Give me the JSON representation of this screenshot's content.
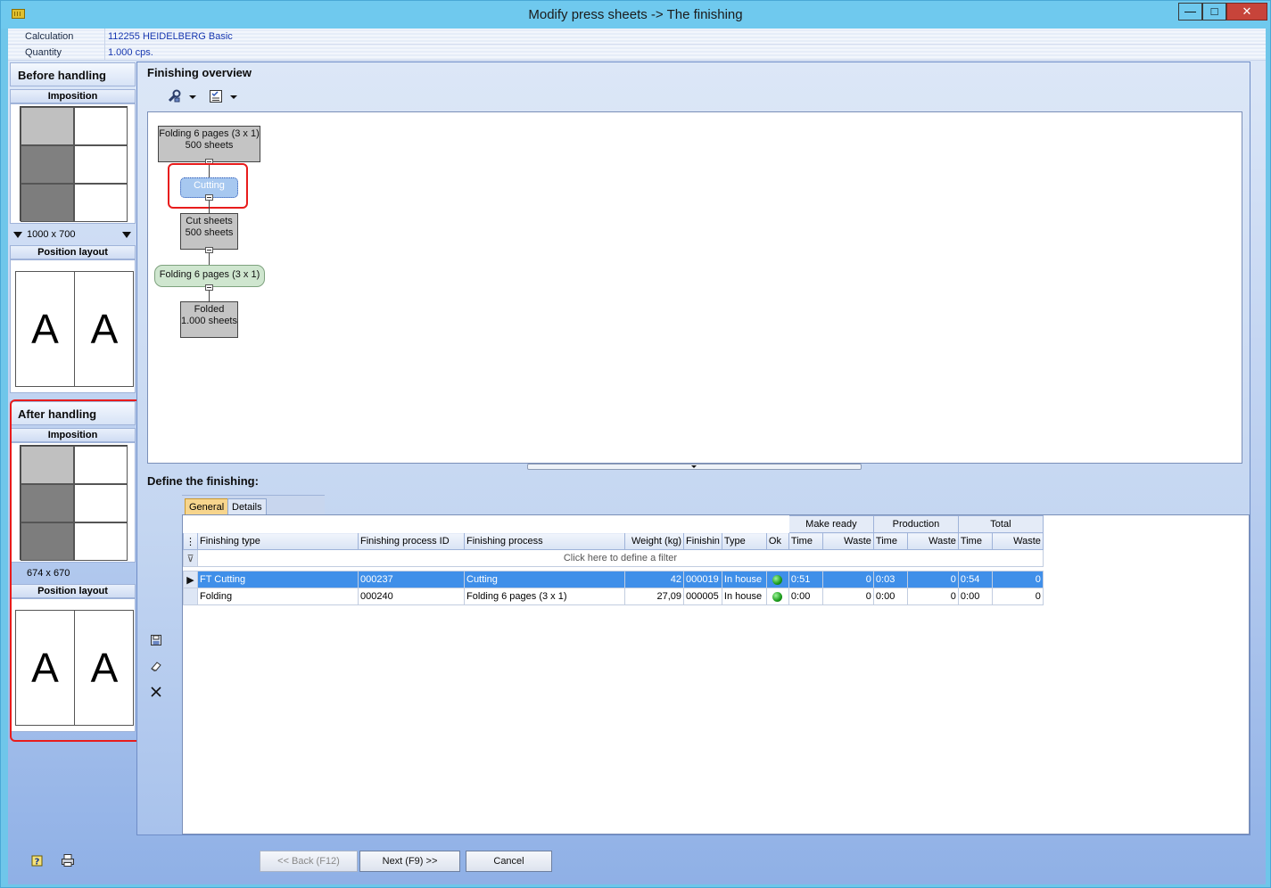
{
  "window": {
    "title": "Modify press sheets -> The finishing",
    "minimize_glyph": "—",
    "maximize_glyph": "□",
    "close_glyph": "✕"
  },
  "info": {
    "calculation_label": "Calculation",
    "calculation_value": "112255 HEIDELBERG Basic",
    "quantity_label": "Quantity",
    "quantity_value": "1.000 cps."
  },
  "before": {
    "header": "Before handling",
    "imposition_label": "Imposition",
    "size": "1000 x 700",
    "position_layout_label": "Position layout",
    "letter_left": "A",
    "letter_right": "A"
  },
  "after": {
    "header": "After handling",
    "imposition_label": "Imposition",
    "size": "674 x 670",
    "position_layout_label": "Position layout",
    "letter_left": "A",
    "letter_right": "A"
  },
  "overview": {
    "title": "Finishing overview",
    "nodes": [
      {
        "line1": "Folding 6 pages (3 x 1)",
        "line2": "500 sheets"
      },
      {
        "line1": "Cutting",
        "line2": ""
      },
      {
        "line1": "Cut sheets",
        "line2": "500 sheets"
      },
      {
        "line1": "Folding 6 pages (3 x 1)",
        "line2": ""
      },
      {
        "line1": "Folded",
        "line2": "1.000 sheets"
      }
    ]
  },
  "define": {
    "title": "Define the finishing:",
    "tabs": [
      "General",
      "Details"
    ],
    "bands": {
      "make_ready": "Make ready",
      "production": "Production",
      "total": "Total"
    },
    "columns": [
      "Finishing type",
      "Finishing process ID",
      "Finishing process",
      "Weight (kg)",
      "Finishin",
      "Type",
      "Ok",
      "Time",
      "Waste",
      "Time",
      "Waste",
      "Time",
      "Waste"
    ],
    "filter_text": "Click here to define a filter",
    "rows": [
      {
        "finishing_type": "FT Cutting",
        "process_id": "000237",
        "process": "Cutting",
        "weight": "42",
        "finishin": "000019",
        "type": "In house",
        "mr_time": "0:51",
        "mr_waste": "0",
        "pr_time": "0:03",
        "pr_waste": "0",
        "tot_time": "0:54",
        "tot_waste": "0"
      },
      {
        "finishing_type": "Folding",
        "process_id": "000240",
        "process": "Folding 6 pages (3 x 1)",
        "weight": "27,09",
        "finishin": "000005",
        "type": "In house",
        "mr_time": "0:00",
        "mr_waste": "0",
        "pr_time": "0:00",
        "pr_waste": "0",
        "tot_time": "0:00",
        "tot_waste": "0"
      }
    ]
  },
  "buttons": {
    "back": "<< Back (F12)",
    "next": "Next (F9) >>",
    "cancel": "Cancel"
  },
  "colors": {
    "titlebar": "#6fc9ee",
    "selected_row": "#3f8fe9",
    "highlight": "#e81c1c",
    "active_tab": "#f7d58d"
  },
  "icons": [
    "app-icon",
    "wrench-icon",
    "checklist-icon",
    "filter-icon",
    "save-icon",
    "eraser-icon",
    "delete-icon",
    "help-icon",
    "print-icon"
  ]
}
